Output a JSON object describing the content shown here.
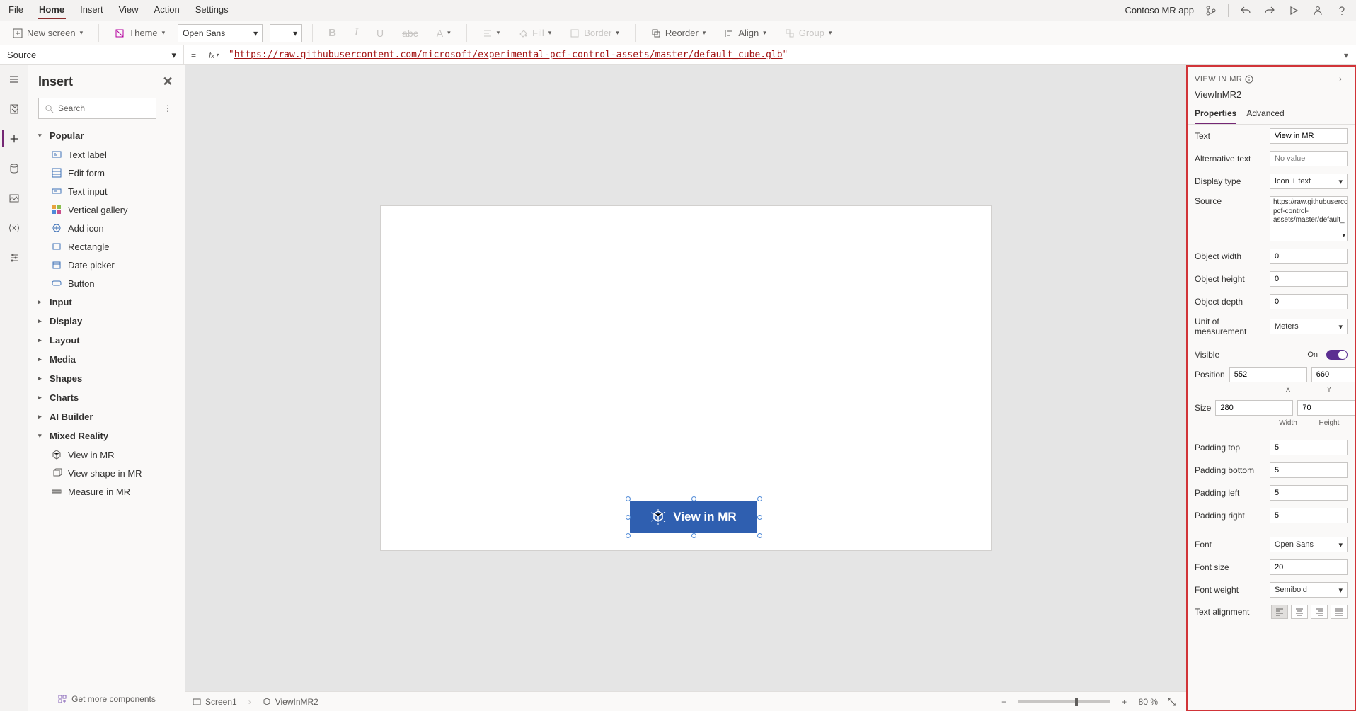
{
  "menubar": {
    "tabs": [
      "File",
      "Home",
      "Insert",
      "View",
      "Action",
      "Settings"
    ],
    "active": "Home",
    "appname": "Contoso MR app"
  },
  "ribbon": {
    "newscreen": "New screen",
    "theme": "Theme",
    "font": "Open Sans",
    "fill": "Fill",
    "border": "Border",
    "reorder": "Reorder",
    "align": "Align",
    "group": "Group"
  },
  "formula": {
    "property": "Source",
    "value": "\"https://raw.githubusercontent.com/microsoft/experimental-pcf-control-assets/master/default_cube.glb\"",
    "url": "https://raw.githubusercontent.com/microsoft/experimental-pcf-control-assets/master/default_cube.glb"
  },
  "insert": {
    "title": "Insert",
    "search_ph": "Search",
    "groups": {
      "popular": "Popular",
      "input": "Input",
      "display": "Display",
      "layout": "Layout",
      "media": "Media",
      "shapes": "Shapes",
      "charts": "Charts",
      "aibuilder": "AI Builder",
      "mixedreality": "Mixed Reality"
    },
    "popular_items": [
      "Text label",
      "Edit form",
      "Text input",
      "Vertical gallery",
      "Add icon",
      "Rectangle",
      "Date picker",
      "Button"
    ],
    "mr_items": [
      "View in MR",
      "View shape in MR",
      "Measure in MR"
    ],
    "getmore": "Get more components"
  },
  "canvas": {
    "button_text": "View in MR"
  },
  "bottombar": {
    "screen": "Screen1",
    "control": "ViewInMR2",
    "zoom": "80 %"
  },
  "props": {
    "header": "VIEW IN MR",
    "control_name": "ViewInMR2",
    "tabs": {
      "properties": "Properties",
      "advanced": "Advanced"
    },
    "labels": {
      "text": "Text",
      "alt": "Alternative text",
      "display": "Display type",
      "source": "Source",
      "ow": "Object width",
      "oh": "Object height",
      "od": "Object depth",
      "unit": "Unit of measurement",
      "visible": "Visible",
      "on": "On",
      "position": "Position",
      "size": "Size",
      "pt": "Padding top",
      "pb": "Padding bottom",
      "pl": "Padding left",
      "pr": "Padding right",
      "font": "Font",
      "fs": "Font size",
      "fw": "Font weight",
      "ta": "Text alignment",
      "x": "X",
      "y": "Y",
      "w": "Width",
      "h": "Height"
    },
    "values": {
      "text": "View in MR",
      "alt_ph": "No value",
      "display": "Icon + text",
      "source": "https://raw.githubusercontent.com/microsoft/experimental-pcf-control-assets/master/default_",
      "ow": "0",
      "oh": "0",
      "od": "0",
      "unit": "Meters",
      "visible": "On",
      "pos_x": "552",
      "pos_y": "660",
      "size_w": "280",
      "size_h": "70",
      "pt": "5",
      "pb": "5",
      "pl": "5",
      "pr": "5",
      "font": "Open Sans",
      "fs": "20",
      "fw": "Semibold"
    }
  }
}
